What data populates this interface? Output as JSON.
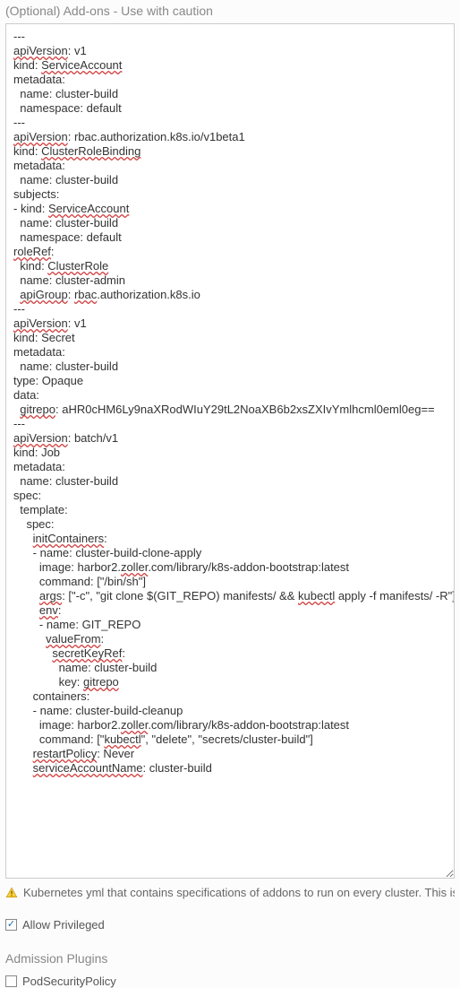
{
  "section_title": "(Optional) Add-ons - Use with caution",
  "info_text": "Kubernetes yml that contains specifications of addons to run on every cluster. This is an ex",
  "allow_privileged_label": "Allow Privileged",
  "allow_privileged_checked": true,
  "plugins_title": "Admission Plugins",
  "pod_security_label": "PodSecurityPolicy",
  "pod_security_checked": false,
  "yaml_segments": [
    "---\n",
    {
      "s": true,
      "t": "apiVersion"
    },
    ": v1\n",
    "kind: ",
    {
      "s": true,
      "t": "ServiceAccount"
    },
    "\n",
    "metadata:\n",
    "  name: cluster-build\n",
    "  namespace: default\n",
    "---\n",
    {
      "s": true,
      "t": "apiVersion"
    },
    ": rbac.authorization.k8s.io/v1beta1\n",
    "kind: ",
    {
      "s": true,
      "t": "ClusterRoleBinding"
    },
    "\n",
    "metadata:\n",
    "  name: cluster-build\n",
    "subjects:\n",
    "- kind: ",
    {
      "s": true,
      "t": "ServiceAccount"
    },
    "\n",
    "  name: cluster-build\n",
    "  namespace: default\n",
    {
      "s": true,
      "t": "roleRef"
    },
    ":\n",
    "  kind: ",
    {
      "s": true,
      "t": "ClusterRole"
    },
    "\n",
    "  name: cluster-admin\n",
    "  ",
    {
      "s": true,
      "t": "apiGroup"
    },
    ": ",
    {
      "s": true,
      "t": "rbac"
    },
    ".authorization.k8s.io\n",
    "---\n",
    {
      "s": true,
      "t": "apiVersion"
    },
    ": v1\n",
    "kind: Secret\n",
    "metadata:\n",
    "  name: cluster-build\n",
    "type: Opaque\n",
    "data:\n",
    "  ",
    {
      "s": true,
      "t": "gitrepo"
    },
    ": aHR0cHM6Ly9naXRodWIuY29tL2NoaXB6b2xsZXIvYmlhcml0eml0eg==\n",
    "---\n",
    {
      "s": true,
      "t": "apiVersion"
    },
    ": batch/v1\n",
    "kind: Job\n",
    "metadata:\n",
    "  name: cluster-build\n",
    "spec:\n",
    "  template:\n",
    "    spec:\n",
    "      ",
    {
      "s": true,
      "t": "initContainers"
    },
    ":\n",
    "      - name: cluster-build-clone-apply\n",
    "        image: harbor2.",
    {
      "s": true,
      "t": "zoller"
    },
    ".com/library/k8s-addon-bootstrap:latest\n",
    "        command: [\"/bin/sh\"]\n",
    "        ",
    {
      "s": true,
      "t": "args"
    },
    ": [\"-c\", \"git clone $(GIT_REPO) manifests/ && ",
    {
      "s": true,
      "t": "kubectl"
    },
    " apply -f manifests/ -R\"]\n",
    "        ",
    {
      "s": true,
      "t": "env"
    },
    ":\n",
    "        - name: GIT_REPO\n",
    "          ",
    {
      "s": true,
      "t": "valueFrom"
    },
    ":\n",
    "            ",
    {
      "s": true,
      "t": "secretKeyRef"
    },
    ":\n",
    "              name: cluster-build\n",
    "              key: ",
    {
      "s": true,
      "t": "gitrepo"
    },
    "\n",
    "      containers:\n",
    "      - name: cluster-build-cleanup\n",
    "        image: harbor2.",
    {
      "s": true,
      "t": "zoller"
    },
    ".com/library/k8s-addon-bootstrap:latest\n",
    "        command: [\"",
    {
      "s": true,
      "t": "kubectl"
    },
    "\", \"delete\", \"secrets/cluster-build\"]\n",
    "      ",
    {
      "s": true,
      "t": "restartPolicy"
    },
    ": Never\n",
    "      ",
    {
      "s": true,
      "t": "serviceAccountName"
    },
    ": cluster-build\n"
  ]
}
